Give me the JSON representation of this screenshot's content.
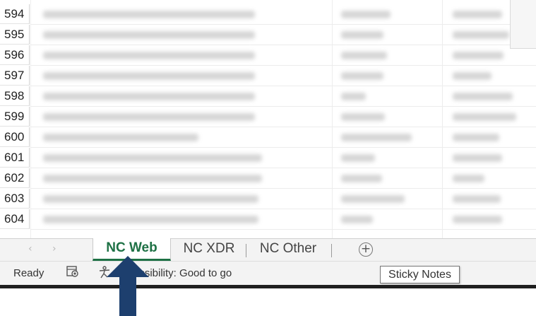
{
  "grid": {
    "row_numbers": [
      "594",
      "595",
      "596",
      "597",
      "598",
      "599",
      "600",
      "601",
      "602",
      "603",
      "604"
    ]
  },
  "sheet_tabs": {
    "nav_prev": "‹",
    "nav_next": "›",
    "tabs": [
      "NC Web",
      "NC XDR",
      "NC Other"
    ],
    "active_index": 0,
    "add_symbol": "+"
  },
  "status_bar": {
    "ready": "Ready",
    "accessibility": "Accessibility: Good to go"
  },
  "tooltip": {
    "text": "Sticky Notes"
  },
  "colors": {
    "accent_green": "#1e7145",
    "arrow_blue": "#1d3f6e"
  }
}
